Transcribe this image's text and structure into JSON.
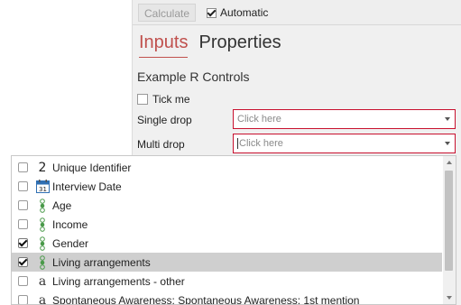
{
  "toolbar": {
    "calculate_label": "Calculate",
    "automatic_label": "Automatic",
    "automatic_checked": true
  },
  "tabs": [
    {
      "label": "Inputs",
      "active": true
    },
    {
      "label": "Properties",
      "active": false
    }
  ],
  "section_title": "Example R Controls",
  "tick_me": {
    "label": "Tick me",
    "checked": false
  },
  "single_drop": {
    "label": "Single drop",
    "placeholder": "Click here"
  },
  "multi_drop": {
    "label": "Multi drop",
    "placeholder": "Click here"
  },
  "accent_color": "#c0504d",
  "list_items": [
    {
      "label": "Unique Identifier",
      "icon": "number-2-icon",
      "checked": false,
      "selected": false
    },
    {
      "label": "Interview Date",
      "icon": "calendar-icon",
      "checked": false,
      "selected": false
    },
    {
      "label": "Age",
      "icon": "categorical-icon",
      "checked": false,
      "selected": false
    },
    {
      "label": "Income",
      "icon": "categorical-icon",
      "checked": false,
      "selected": false
    },
    {
      "label": "Gender",
      "icon": "categorical-icon",
      "checked": true,
      "selected": false
    },
    {
      "label": "Living arrangements",
      "icon": "categorical-icon",
      "checked": true,
      "selected": true
    },
    {
      "label": "Living arrangements - other",
      "icon": "text-a-icon",
      "checked": false,
      "selected": false
    },
    {
      "label": "Spontaneous Awareness: Spontaneous Awareness: 1st mention",
      "icon": "text-a-icon",
      "checked": false,
      "selected": false
    }
  ],
  "icon_glyphs": {
    "number": "2",
    "text": "a",
    "calendar_day": "31"
  }
}
